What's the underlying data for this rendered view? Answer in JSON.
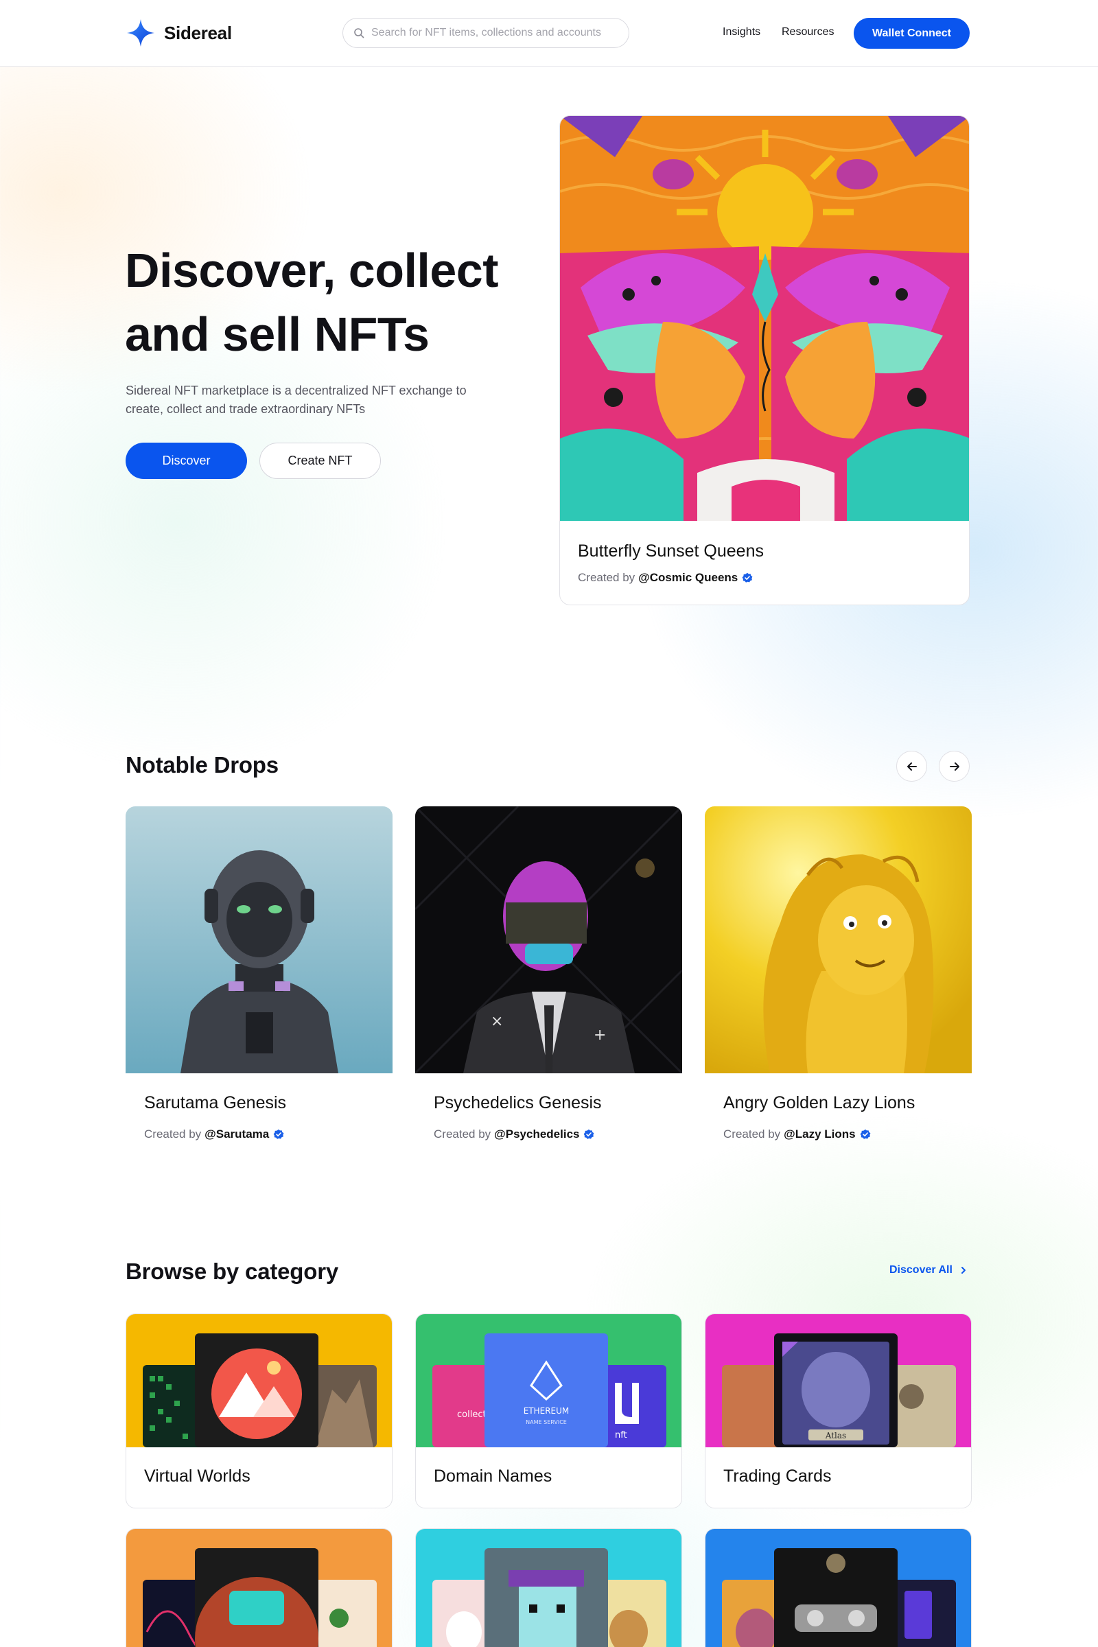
{
  "header": {
    "brand": "Sidereal",
    "search_placeholder": "Search for NFT items, collections and accounts",
    "nav": [
      "Insights",
      "Resources"
    ],
    "wallet_button": "Wallet Connect"
  },
  "hero": {
    "title": "Discover, collect and sell NFTs",
    "subtitle": "Sidereal NFT marketplace is a decentralized NFT exchange to create, collect and trade extraordinary NFTs",
    "primary_button": "Discover",
    "secondary_button": "Create NFT",
    "featured": {
      "title": "Butterfly Sunset Queens",
      "by_label": "Created by",
      "creator": "@Cosmic Queens"
    }
  },
  "drops": {
    "title": "Notable Drops",
    "items": [
      {
        "title": "Sarutama Genesis",
        "by_label": "Created by",
        "creator": "@Sarutama"
      },
      {
        "title": "Psychedelics Genesis",
        "by_label": "Created by",
        "creator": "@Psychedelics"
      },
      {
        "title": "Angry Golden Lazy Lions",
        "by_label": "Created by",
        "creator": "@Lazy Lions"
      }
    ]
  },
  "categories": {
    "title": "Browse by category",
    "discover_all": "Discover All",
    "items": [
      {
        "label": "Virtual Worlds",
        "color": "#f5b800"
      },
      {
        "label": "Domain Names",
        "color": "#35c06e"
      },
      {
        "label": "Trading Cards",
        "color": "#e82fc3"
      },
      {
        "label": "",
        "color": "#f39a3e"
      },
      {
        "label": "",
        "color": "#2fcfe0"
      },
      {
        "label": "",
        "color": "#2484ec"
      }
    ],
    "art_text": {
      "ens_line1": "ETHEREUM",
      "ens_line2": "NAME SERVICE",
      "collect": "collect",
      "nft": "nft",
      "atlas": "Atlas"
    }
  },
  "colors": {
    "accent": "#0a55ee",
    "verified": "#1a5fe8"
  },
  "icons": [
    "sidereal-logo-icon",
    "search-icon",
    "arrow-left-icon",
    "arrow-right-icon",
    "chevron-right-icon",
    "verified-badge-icon"
  ]
}
